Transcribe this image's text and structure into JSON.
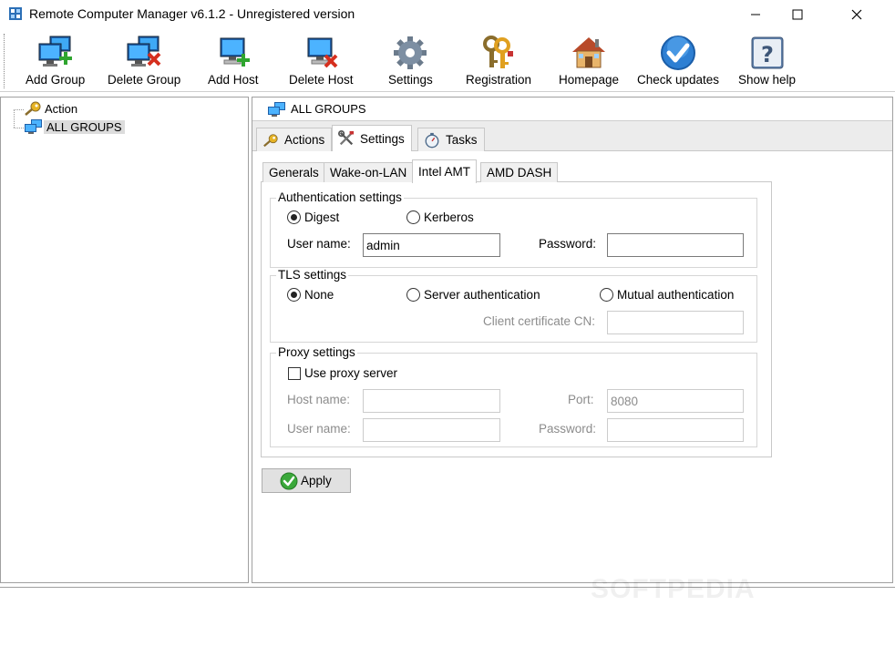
{
  "window": {
    "title": "Remote Computer Manager v6.1.2 - Unregistered version",
    "minimize_glyph": "—",
    "maximize_glyph": "☐",
    "close_glyph": "✕"
  },
  "toolbar": {
    "items": [
      {
        "label": "Add Group",
        "icon": "add-group-icon"
      },
      {
        "label": "Delete Group",
        "icon": "delete-group-icon"
      },
      {
        "label": "Add Host",
        "icon": "add-host-icon"
      },
      {
        "label": "Delete Host",
        "icon": "delete-host-icon"
      },
      {
        "label": "Settings",
        "icon": "gear-icon"
      },
      {
        "label": "Registration",
        "icon": "keys-icon"
      },
      {
        "label": "Homepage",
        "icon": "house-icon"
      },
      {
        "label": "Check updates",
        "icon": "check-icon"
      },
      {
        "label": "Show help",
        "icon": "question-icon"
      }
    ]
  },
  "tree": {
    "items": [
      {
        "label": "Action",
        "icon": "key-icon"
      },
      {
        "label": "ALL GROUPS",
        "icon": "network-icon"
      }
    ]
  },
  "header": {
    "group_label": "ALL GROUPS"
  },
  "main_tabs": [
    {
      "label": "Actions",
      "icon": "key-icon"
    },
    {
      "label": "Settings",
      "icon": "tools-icon",
      "selected": true
    },
    {
      "label": "Tasks",
      "icon": "stopwatch-icon"
    }
  ],
  "sub_tabs": [
    {
      "label": "Generals"
    },
    {
      "label": "Wake-on-LAN"
    },
    {
      "label": "Intel AMT",
      "selected": true
    },
    {
      "label": "AMD DASH"
    }
  ],
  "auth": {
    "title": "Authentication settings",
    "options": [
      {
        "label": "Digest",
        "selected": true
      },
      {
        "label": "Kerberos",
        "selected": false
      }
    ],
    "username_label": "User name:",
    "username_value": "admin",
    "password_label": "Password:",
    "password_value": ""
  },
  "tls": {
    "title": "TLS settings",
    "options": [
      {
        "label": "None",
        "selected": true
      },
      {
        "label": "Server authentication",
        "selected": false
      },
      {
        "label": "Mutual authentication",
        "selected": false
      }
    ],
    "client_cert_label": "Client certificate CN:",
    "client_cert_value": ""
  },
  "proxy": {
    "title": "Proxy settings",
    "use_proxy_label": "Use proxy server",
    "use_proxy_checked": false,
    "host_label": "Host name:",
    "host_value": "",
    "port_label": "Port:",
    "port_value": "8080",
    "user_label": "User name:",
    "user_value": "",
    "password_label": "Password:",
    "password_value": ""
  },
  "apply_label": "Apply",
  "watermark": "SOFTPEDIA"
}
